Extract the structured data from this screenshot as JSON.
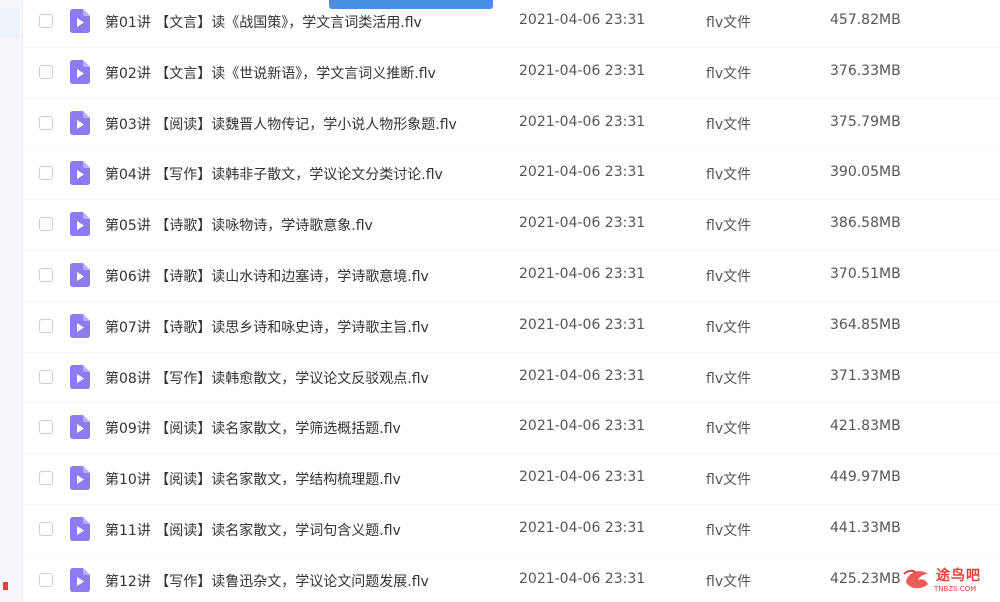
{
  "files": [
    {
      "name": "第01讲 【文言】读《战国策》，学文言词类活用.flv",
      "date": "2021-04-06 23:31",
      "type": "flv文件",
      "size": "457.82MB"
    },
    {
      "name": "第02讲 【文言】读《世说新语》，学文言词义推断.flv",
      "date": "2021-04-06 23:31",
      "type": "flv文件",
      "size": "376.33MB"
    },
    {
      "name": "第03讲 【阅读】读魏晋人物传记，学小说人物形象题.flv",
      "date": "2021-04-06 23:31",
      "type": "flv文件",
      "size": "375.79MB"
    },
    {
      "name": "第04讲 【写作】读韩非子散文，学议论文分类讨论.flv",
      "date": "2021-04-06 23:31",
      "type": "flv文件",
      "size": "390.05MB"
    },
    {
      "name": "第05讲 【诗歌】读咏物诗，学诗歌意象.flv",
      "date": "2021-04-06 23:31",
      "type": "flv文件",
      "size": "386.58MB"
    },
    {
      "name": "第06讲 【诗歌】读山水诗和边塞诗，学诗歌意境.flv",
      "date": "2021-04-06 23:31",
      "type": "flv文件",
      "size": "370.51MB"
    },
    {
      "name": "第07讲 【诗歌】读思乡诗和咏史诗，学诗歌主旨.flv",
      "date": "2021-04-06 23:31",
      "type": "flv文件",
      "size": "364.85MB"
    },
    {
      "name": "第08讲 【写作】读韩愈散文，学议论文反驳观点.flv",
      "date": "2021-04-06 23:31",
      "type": "flv文件",
      "size": "371.33MB"
    },
    {
      "name": "第09讲 【阅读】读名家散文，学筛选概括题.flv",
      "date": "2021-04-06 23:31",
      "type": "flv文件",
      "size": "421.83MB"
    },
    {
      "name": "第10讲 【阅读】读名家散文，学结构梳理题.flv",
      "date": "2021-04-06 23:31",
      "type": "flv文件",
      "size": "449.97MB"
    },
    {
      "name": "第11讲 【阅读】读名家散文，学词句含义题.flv",
      "date": "2021-04-06 23:31",
      "type": "flv文件",
      "size": "441.33MB"
    },
    {
      "name": "第12讲 【写作】读鲁迅杂文，学议论文问题发展.flv",
      "date": "2021-04-06 23:31",
      "type": "flv文件",
      "size": "425.23MB"
    }
  ],
  "icons": {
    "file": "video-file-icon",
    "logo": "bird-logo-icon"
  },
  "colors": {
    "file_icon": "#8d7cf0",
    "accent_bar": "#4a90e2",
    "watermark": "#e8413c"
  },
  "watermark": {
    "name": "途鸟吧",
    "url": "TNBZS.COM"
  }
}
